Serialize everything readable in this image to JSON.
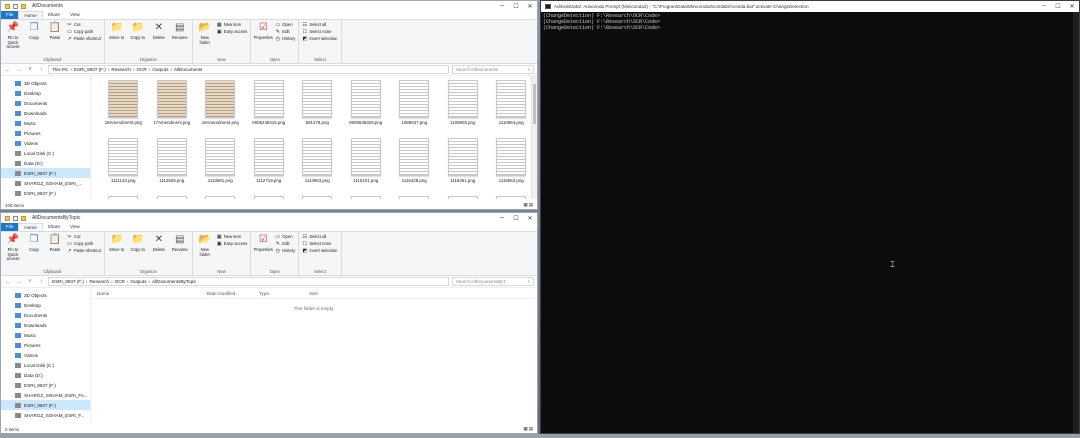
{
  "explorer_top": {
    "title": "AllDocuments",
    "tabs": [
      "File",
      "Home",
      "Share",
      "View"
    ],
    "ribbon": {
      "clipboard": {
        "label": "Clipboard",
        "pin": "Pin to Quick access",
        "copy": "Copy",
        "paste": "Paste",
        "cut": "Cut",
        "copy_path": "Copy path",
        "paste_shortcut": "Paste shortcut"
      },
      "organize": {
        "label": "Organize",
        "move": "Move to",
        "copy": "Copy to",
        "delete": "Delete",
        "rename": "Rename"
      },
      "new": {
        "label": "New",
        "folder": "New folder",
        "item": "New item",
        "easy": "Easy access"
      },
      "open": {
        "label": "Open",
        "properties": "Properties",
        "open": "Open",
        "edit": "Edit",
        "history": "History"
      },
      "select": {
        "label": "Select",
        "all": "Select all",
        "none": "Select none",
        "invert": "Invert selection"
      }
    },
    "address": [
      "This PC",
      "ESRI_9937 (F:)",
      "Research",
      "OCR",
      "Outputs",
      "AllDocuments"
    ],
    "search_placeholder": "Search AllDocuments",
    "nav": [
      "3D Objects",
      "Desktop",
      "Documents",
      "Downloads",
      "Music",
      "Pictures",
      "Videos",
      "Local Disk (C:)",
      "Data (D:)",
      "ESRI_9937 (F:)",
      "SHARGZ_SOHAM_ESRI_...",
      "ESRI_9937 (F:)"
    ],
    "nav_selected": 9,
    "files": [
      {
        "name": "18Amendment.png",
        "old": true
      },
      {
        "name": "17Amendment.png",
        "old": true
      },
      {
        "name": "19Amendment.png",
        "old": true
      },
      {
        "name": "0005248416.png",
        "old": false
      },
      {
        "name": "581278.png",
        "old": false
      },
      {
        "name": "0000948325.png",
        "old": false
      },
      {
        "name": "1088637.png",
        "old": false
      },
      {
        "name": "1108903.png",
        "old": false
      },
      {
        "name": "1110854.png",
        "old": false
      },
      {
        "name": "1111143.png",
        "old": false
      },
      {
        "name": "1112528.png",
        "old": false
      },
      {
        "name": "1113681.png",
        "old": false
      },
      {
        "name": "1112719.png",
        "old": false
      },
      {
        "name": "1114963.png",
        "old": false
      },
      {
        "name": "1115101.png",
        "old": false
      },
      {
        "name": "1115428.png",
        "old": false
      },
      {
        "name": "1116461.png",
        "old": false
      },
      {
        "name": "1116653.png",
        "old": false
      },
      {
        "name": "",
        "old": false
      },
      {
        "name": "",
        "old": false
      },
      {
        "name": "",
        "old": false
      },
      {
        "name": "",
        "old": false
      },
      {
        "name": "",
        "old": false
      },
      {
        "name": "",
        "old": false
      },
      {
        "name": "",
        "old": false
      },
      {
        "name": "",
        "old": false
      },
      {
        "name": "",
        "old": false
      }
    ],
    "status": "100 items"
  },
  "explorer_bottom": {
    "title": "AllDocumentsByTopic",
    "tabs": [
      "File",
      "Home",
      "Share",
      "View"
    ],
    "address": [
      "ESRI_9937 (F:)",
      "Research",
      "OCR",
      "Outputs",
      "AllDocumentsByTopic"
    ],
    "search_placeholder": "Search AllDocumentsByT...",
    "columns": [
      "Name",
      "Date modified",
      "Type",
      "Size"
    ],
    "empty_text": "This folder is empty.",
    "nav": [
      "3D Objects",
      "Desktop",
      "Documents",
      "Downloads",
      "Music",
      "Pictures",
      "Videos",
      "Local Disk (C:)",
      "Data (D:)",
      "ESRI_9937 (F:)",
      "SHARGZ_SOHAM_ESRI_Fo...",
      "ESRI_9937 (F:)",
      "SHARGZ_SOHAM_ESRI_F..."
    ],
    "nav_selected": 11,
    "status": "0 items"
  },
  "console": {
    "title": "Administrator: Anaconda Prompt (Miniconda3) - \"C:\\ProgramData\\Miniconda3\\condabin\\conda.bat\" activate ChangeDetection",
    "lines": [
      "(ChangeDetection) F:\\Research\\OCR\\Code>",
      "(ChangeDetection) F:\\Research\\OCR\\Code>",
      "(ChangeDetection) F:\\Research\\OCR\\Code>"
    ]
  },
  "colors": {
    "accent": "#1979ca",
    "selection": "#cce8ff",
    "console_bg": "#0c0c0c",
    "console_fg": "#cccccc"
  }
}
